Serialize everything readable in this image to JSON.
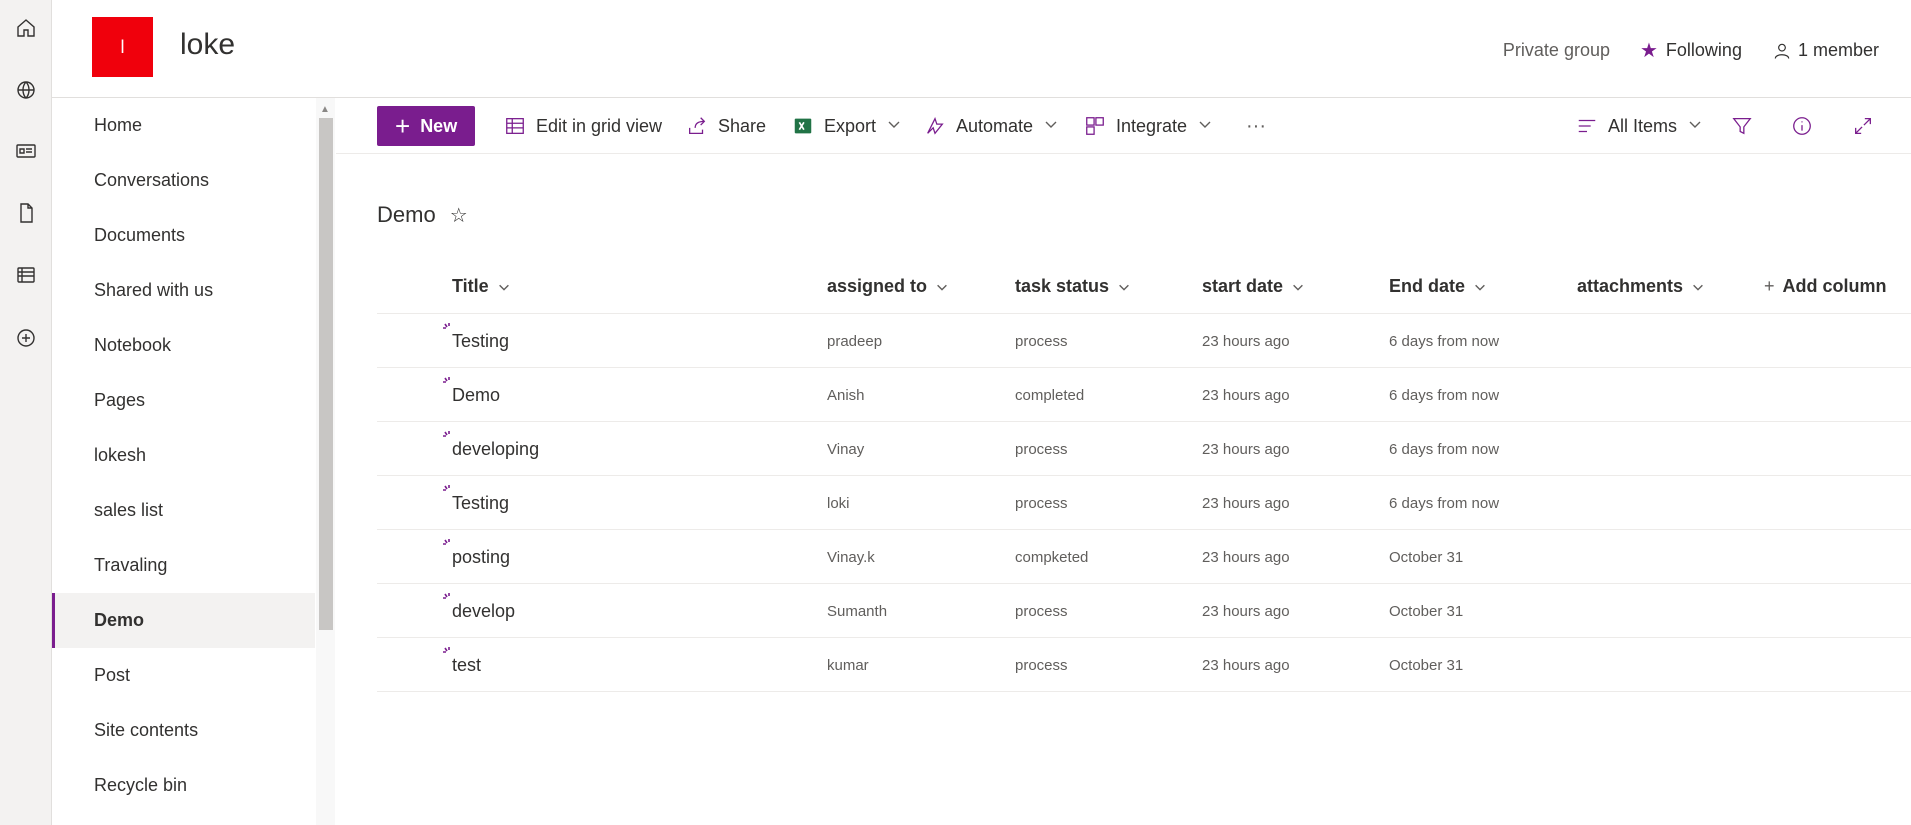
{
  "site": {
    "logo_letter": "l",
    "title": "loke",
    "privacy": "Private group",
    "follow_label": "Following",
    "members_label": "1 member"
  },
  "nav": {
    "items": [
      {
        "label": "Home"
      },
      {
        "label": "Conversations"
      },
      {
        "label": "Documents"
      },
      {
        "label": "Shared with us"
      },
      {
        "label": "Notebook"
      },
      {
        "label": "Pages"
      },
      {
        "label": "lokesh"
      },
      {
        "label": "sales list"
      },
      {
        "label": "Travaling"
      },
      {
        "label": "Demo"
      },
      {
        "label": "Post"
      },
      {
        "label": "Site contents"
      },
      {
        "label": "Recycle bin"
      }
    ],
    "active": "Demo"
  },
  "commands": {
    "new_label": "New",
    "grid_view_label": "Edit in grid view",
    "share_label": "Share",
    "export_label": "Export",
    "automate_label": "Automate",
    "integrate_label": "Integrate",
    "more_label": "···",
    "view_label": "All Items"
  },
  "list": {
    "title": "Demo",
    "columns": [
      "Title",
      "assigned to",
      "task status",
      "start date",
      "End date",
      "attachments"
    ],
    "add_column_label": "Add column",
    "rows": [
      {
        "title": "Testing",
        "assigned_to": "pradeep",
        "status": "process",
        "start": "23 hours ago",
        "end": "6 days from now"
      },
      {
        "title": "Demo",
        "assigned_to": "Anish",
        "status": "completed",
        "start": "23 hours ago",
        "end": "6 days from now"
      },
      {
        "title": "developing",
        "assigned_to": "Vinay",
        "status": "process",
        "start": "23 hours ago",
        "end": "6 days from now"
      },
      {
        "title": "Testing",
        "assigned_to": "loki",
        "status": "process",
        "start": "23 hours ago",
        "end": "6 days from now"
      },
      {
        "title": "posting",
        "assigned_to": "Vinay.k",
        "status": "compketed",
        "start": "23 hours ago",
        "end": "October 31"
      },
      {
        "title": "develop",
        "assigned_to": "Sumanth",
        "status": "process",
        "start": "23 hours ago",
        "end": "October 31"
      },
      {
        "title": "test",
        "assigned_to": "kumar",
        "status": "process",
        "start": "23 hours ago",
        "end": "October 31"
      }
    ]
  },
  "colors": {
    "accent": "#7a1d8e",
    "logo": "#f0000c"
  }
}
